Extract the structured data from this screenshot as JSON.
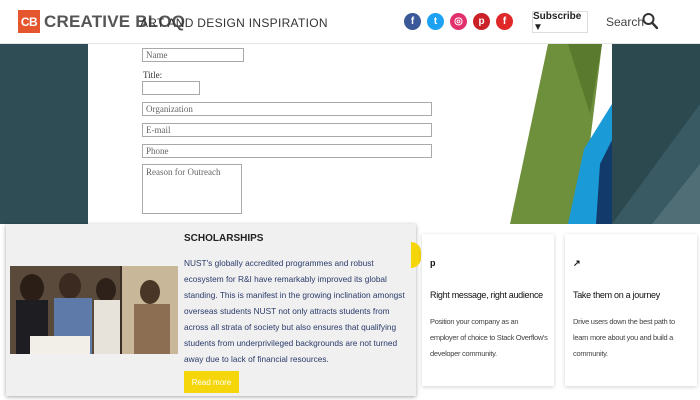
{
  "header": {
    "logo_mark": "CB",
    "logo_text": "CREATIVE BLOQ",
    "tagline": "ART AND DESIGN INSPIRATION",
    "social": [
      {
        "name": "facebook",
        "glyph": "f",
        "color": "#3b5998"
      },
      {
        "name": "twitter",
        "glyph": "t",
        "color": "#1da1f2"
      },
      {
        "name": "instagram",
        "glyph": "◎",
        "color": "#e1306c"
      },
      {
        "name": "pinterest",
        "glyph": "p",
        "color": "#cb2027"
      },
      {
        "name": "flipboard",
        "glyph": "f",
        "color": "#e12828"
      }
    ],
    "subscribe_label": "Subscribe ▼",
    "search_label": "Search"
  },
  "form": {
    "name_placeholder": "Name",
    "title_label": "Title:",
    "organization_placeholder": "Organization",
    "email_placeholder": "E-mail",
    "phone_placeholder": "Phone",
    "reason_placeholder": "Reason for Outreach"
  },
  "scholarships": {
    "title": "SCHOLARSHIPS",
    "body": "NUST's globally accredited programmes and robust ecosystem for R&I have remarkably improved its global standing. This is manifest in the growing inclination amongst overseas students NUST not only attracts students from across all strata of society but also ensures that qualifying students from underprivileged backgrounds are not turned away due to lack of financial resources.",
    "button_label": "Read more"
  },
  "cards": [
    {
      "icon": "p",
      "title": "Right message, right audience",
      "text": "Position your company as an employer of choice to Stack Overflow's developer community."
    },
    {
      "icon": "↗",
      "title": "Take them on a journey",
      "text": "Drive users down the best path to learn more about you and build a community."
    }
  ],
  "colors": {
    "accent": "#e5552e",
    "button": "#f5d60a",
    "backdrop": "#2f4d55"
  }
}
